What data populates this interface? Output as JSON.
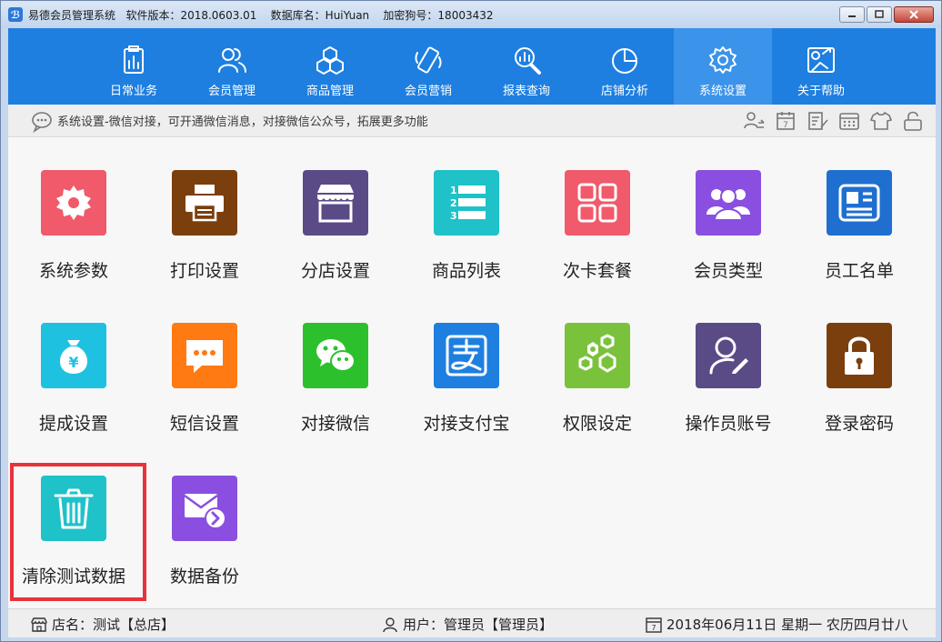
{
  "window": {
    "title": "易德会员管理系统   软件版本：2018.0603.01    数据库名：HuiYuan    加密狗号：18003432",
    "app_icon": "ℬ"
  },
  "nav": {
    "items": [
      {
        "label": "日常业务",
        "icon": "clipboard-chart-icon"
      },
      {
        "label": "会员管理",
        "icon": "users-icon"
      },
      {
        "label": "商品管理",
        "icon": "cubes-icon"
      },
      {
        "label": "会员营销",
        "icon": "phone-icon"
      },
      {
        "label": "报表查询",
        "icon": "search-chart-icon"
      },
      {
        "label": "店铺分析",
        "icon": "pie-icon"
      },
      {
        "label": "系统设置",
        "icon": "gear-icon",
        "active": true
      },
      {
        "label": "关于帮助",
        "icon": "help-icon"
      }
    ]
  },
  "infobar": {
    "text": "系统设置-微信对接，可开通微信消息，对接微信公众号，拓展更多功能"
  },
  "tiles": [
    {
      "label": "系统参数",
      "color": "#f05a6a",
      "icon": "gear-icon"
    },
    {
      "label": "打印设置",
      "color": "#7a3f0d",
      "icon": "printer-icon"
    },
    {
      "label": "分店设置",
      "color": "#5a4a86",
      "icon": "store-icon"
    },
    {
      "label": "商品列表",
      "color": "#1ec2c8",
      "icon": "list-icon"
    },
    {
      "label": "次卡套餐",
      "color": "#f05a6a",
      "icon": "grid-icon"
    },
    {
      "label": "会员类型",
      "color": "#8a4fe0",
      "icon": "members-icon"
    },
    {
      "label": "员工名单",
      "color": "#1e6fd0",
      "icon": "id-card-icon"
    },
    {
      "label": "提成设置",
      "color": "#1ec2e0",
      "icon": "money-bag-icon"
    },
    {
      "label": "短信设置",
      "color": "#ff7a12",
      "icon": "message-icon"
    },
    {
      "label": "对接微信",
      "color": "#2cc12c",
      "icon": "wechat-icon"
    },
    {
      "label": "对接支付宝",
      "color": "#1e7fe0",
      "icon": "alipay-icon"
    },
    {
      "label": "权限设定",
      "color": "#7bc23c",
      "icon": "hexagon-gears-icon"
    },
    {
      "label": "操作员账号",
      "color": "#5a4a86",
      "icon": "operator-icon"
    },
    {
      "label": "登录密码",
      "color": "#7a3f0d",
      "icon": "lock-icon"
    },
    {
      "label": "清除测试数据",
      "color": "#1ec2c8",
      "icon": "trash-icon"
    },
    {
      "label": "数据备份",
      "color": "#8a4fe0",
      "icon": "backup-mail-icon"
    }
  ],
  "status": {
    "store": "店名：测试【总店】",
    "user": "用户：管理员【管理员】",
    "date": "2018年06月11日 星期一 农历四月廿八"
  }
}
